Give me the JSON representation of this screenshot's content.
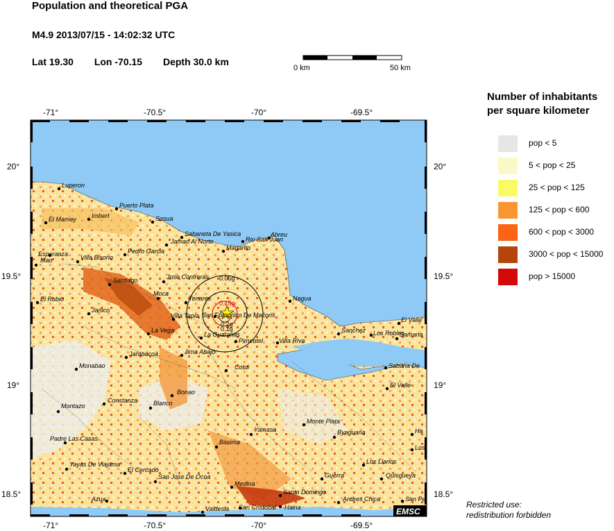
{
  "header": {
    "title": "Population and theoretical PGA",
    "event": "M4.9  2013/07/15 - 14:02:32 UTC",
    "lat": "Lat 19.30",
    "lon": "Lon -70.15",
    "depth": "Depth  30.0 km"
  },
  "scale_bar": {
    "start_label": "0 km",
    "end_label": "50 km"
  },
  "legend": {
    "title_line1": "Number of inhabitants",
    "title_line2": "per square kilometer",
    "items": [
      {
        "label": "pop < 5",
        "color": "#e6e6e6"
      },
      {
        "label": "5 < pop < 25",
        "color": "#fafac8"
      },
      {
        "label": "25 < pop < 125",
        "color": "#fafa64"
      },
      {
        "label": "125 < pop < 600",
        "color": "#fa9632"
      },
      {
        "label": "600 < pop < 3000",
        "color": "#fa6414"
      },
      {
        "label": "3000 < pop < 15000",
        "color": "#b4460a"
      },
      {
        "label": "pop > 15000",
        "color": "#d20a0a"
      }
    ]
  },
  "axes": {
    "lon_ticks": [
      "-71°",
      "-70.5°",
      "-70°",
      "-69.5°"
    ],
    "lat_ticks": [
      "20°",
      "19.5°",
      "19°",
      "18.5°"
    ]
  },
  "pga_labels": [
    "0.05g",
    "0.15g",
    "0.2g",
    "0.1g"
  ],
  "cities": [
    "Luperon",
    "Puerto Plata",
    "El Mamey",
    "Imbert",
    "Sosua",
    "Sabaneta De Yasica",
    "Abreu",
    "Jamao Al Norte",
    "Rio San Juan",
    "Esperanza",
    "Pedro Garcia",
    "Maganto",
    "Mao",
    "Villa Bisono",
    "Santiago",
    "Jose Contreras",
    "El Rubio",
    "Moca",
    "Tenares",
    "Nagua",
    "Janico",
    "San Francisco De Macoris",
    "Villa Tapia",
    "La Vega",
    "La Guaranas",
    "Pimentel",
    "Villa Riva",
    "Sanchez",
    "Los Robles",
    "El Valle",
    "Samana",
    "Jarabacoa",
    "Jima Abajo",
    "Monabao",
    "Cotui",
    "Sabana De",
    "El Valle",
    "Bonao",
    "Constanza",
    "Blanco",
    "Montazo",
    "Monte Plata",
    "Yamasa",
    "Padre Las Casas",
    "Basima",
    "Byaguana",
    "Ha",
    "Los",
    "Yayas De Viajama",
    "El Cercado",
    "Los Llanos",
    "Guerra",
    "Quisqueya",
    "San Jose De Ocoa",
    "Medina",
    "Santo Domingo",
    "Andres Chica",
    "San Pe",
    "Azua",
    "Valdesia",
    "San Cristobal",
    "Haina"
  ],
  "logo": "EMSC",
  "restricted": {
    "line1": "Restricted use:",
    "line2": "redistribution forbidden"
  }
}
